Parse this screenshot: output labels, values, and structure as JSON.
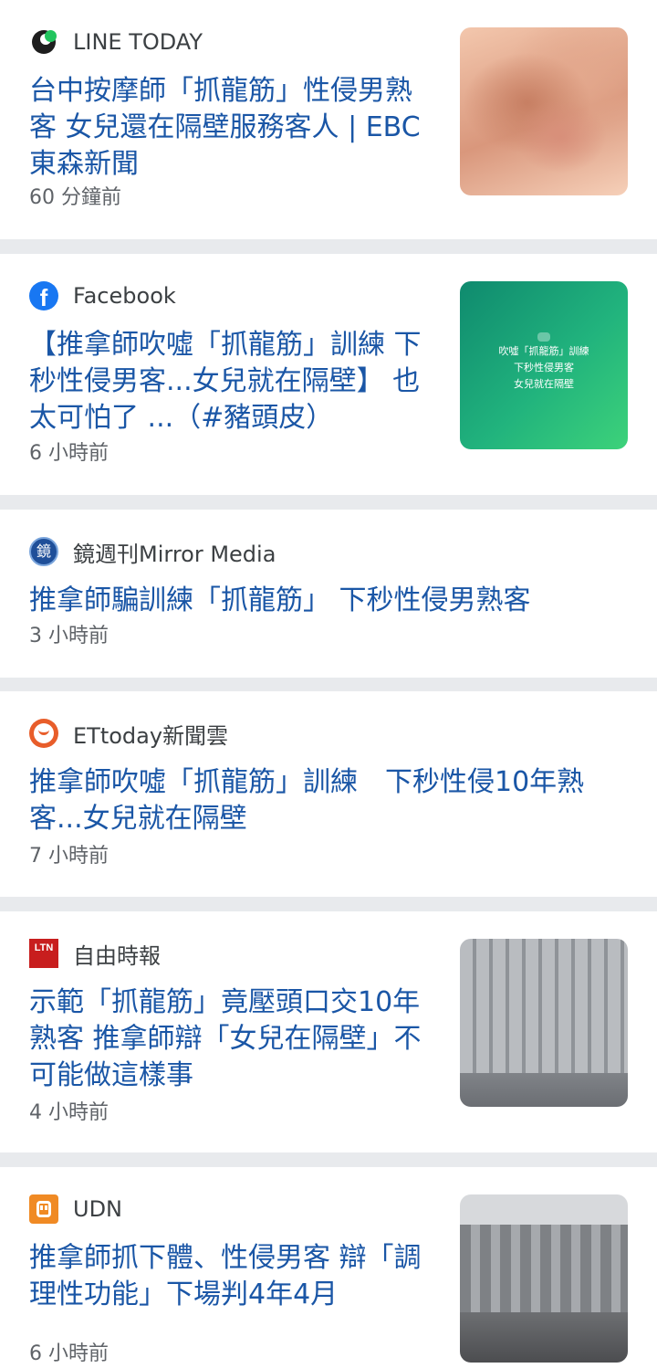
{
  "feed": {
    "items": [
      {
        "source": "LINE TODAY",
        "source_icon": "line-today-icon",
        "title": "台中按摩師「抓龍筋」性侵男熟客 女兒還在隔壁服務客人 | EBC 東森新聞",
        "time": "60 分鐘前",
        "thumbnail": "massage-photo"
      },
      {
        "source": "Facebook",
        "source_icon": "facebook-icon",
        "title": "【推拿師吹噓「抓龍筋」訓練 下秒性侵男客...女兒就在隔壁】 也太可怕了 ...（#豬頭皮）",
        "time": "6 小時前",
        "thumbnail": "green-text-card",
        "thumbnail_text": [
          "吹噓「抓龍筋」訓練",
          "下秒性侵男客",
          "女兒就在隔壁"
        ]
      },
      {
        "source": "鏡週刊Mirror Media",
        "source_icon": "mirror-media-icon",
        "title": "推拿師騙訓練「抓龍筋」 下秒性侵男熟客",
        "time": "3 小時前"
      },
      {
        "source": "ETtoday新聞雲",
        "source_icon": "ettoday-icon",
        "title": "推拿師吹噓「抓龍筋」訓練　下秒性侵10年熟客...女兒就在隔壁",
        "time": "7 小時前"
      },
      {
        "source": "自由時報",
        "source_icon": "ltn-icon",
        "icon_text": "LTN",
        "title": "示範「抓龍筋」竟壓頭口交10年熟客 推拿師辯「女兒在隔壁」不可能做這樣事",
        "time": "4 小時前",
        "thumbnail": "court-building-photo"
      },
      {
        "source": "UDN",
        "source_icon": "udn-icon",
        "title": "推拿師抓下體、性侵男客 辯「調理性功能」下場判4年4月",
        "time": "6 小時前",
        "thumbnail": "court-building-photo"
      }
    ]
  },
  "colors": {
    "title": "#1a56a6",
    "source": "#3c4043",
    "time": "#5f6368",
    "separator": "#e8eaed"
  }
}
